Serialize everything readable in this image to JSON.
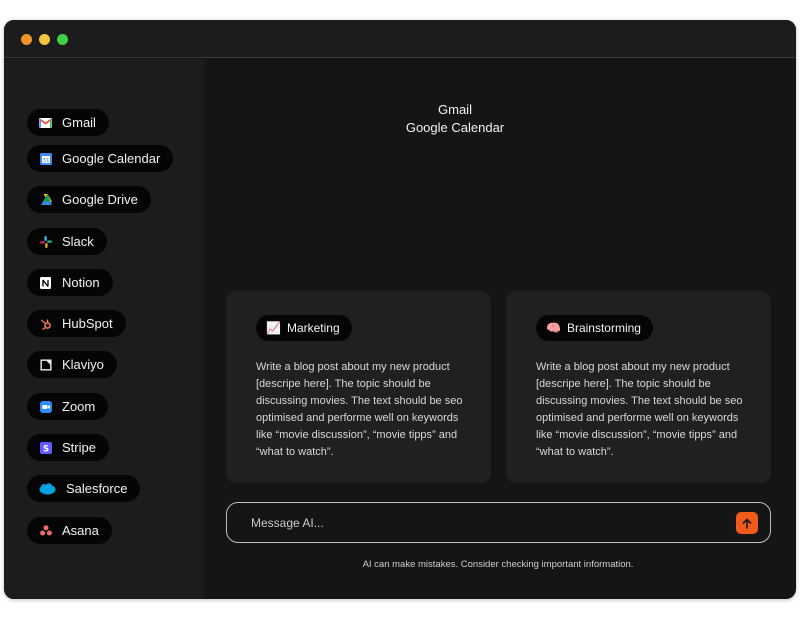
{
  "sidebar": {
    "items": [
      {
        "label": "Gmail",
        "icon": "gmail-icon"
      },
      {
        "label": "Google Calendar",
        "icon": "google-calendar-icon"
      },
      {
        "label": "Google Drive",
        "icon": "google-drive-icon"
      },
      {
        "label": "Slack",
        "icon": "slack-icon"
      },
      {
        "label": "Notion",
        "icon": "notion-icon"
      },
      {
        "label": "HubSpot",
        "icon": "hubspot-icon"
      },
      {
        "label": "Klaviyo",
        "icon": "klaviyo-icon"
      },
      {
        "label": "Zoom",
        "icon": "zoom-icon"
      },
      {
        "label": "Stripe",
        "icon": "stripe-icon"
      },
      {
        "label": "Salesforce",
        "icon": "salesforce-icon"
      },
      {
        "label": "Asana",
        "icon": "asana-icon"
      }
    ]
  },
  "main": {
    "connected": [
      "Gmail",
      "Google Calendar"
    ],
    "cards": [
      {
        "tag": "Marketing",
        "emoji": "📈",
        "text": "Write a blog post about my new product [descripe here]. The topic should be discussing movies. The text should be seo optimised and performe well on keywords like “movie discussion”, “movie tipps” and “what to watch”."
      },
      {
        "tag": "Brainstorming",
        "emoji": "🧠",
        "text": "Write a blog post about my new product [descripe here]. The topic should be discussing movies. The text should be seo optimised and performe well on keywords like “movie discussion”, “movie tipps” and “what to watch”."
      }
    ],
    "composer": {
      "placeholder": "Message AI...",
      "send_icon": "arrow-up-icon"
    },
    "disclaimer": "AI can make mistakes. Consider checking important information."
  },
  "colors": {
    "window_bg": "#151515",
    "sidebar_bg": "#1c1c1c",
    "card_bg": "#202020",
    "pill_bg": "#050505",
    "accent": "#f05a1a",
    "traffic_red": "#f0932b",
    "traffic_yellow": "#f5c542",
    "traffic_green": "#42cf48"
  }
}
